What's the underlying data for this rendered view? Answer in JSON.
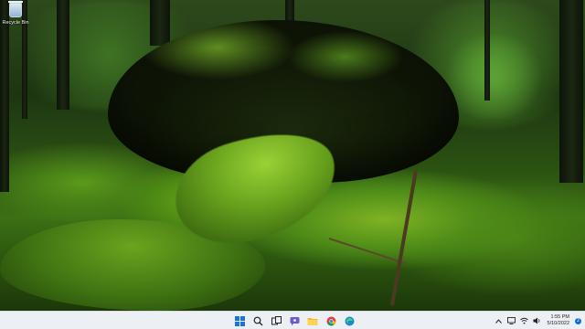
{
  "desktop": {
    "icons": [
      {
        "label": "Recycle Bin",
        "icon": "recycle-bin-icon"
      }
    ],
    "wallpaper": "forest-moss-rock"
  },
  "taskbar": {
    "pinned": [
      {
        "name": "start",
        "icon": "windows-start-icon"
      },
      {
        "name": "search",
        "icon": "search-icon"
      },
      {
        "name": "task-view",
        "icon": "task-view-icon"
      },
      {
        "name": "chat",
        "icon": "chat-icon"
      },
      {
        "name": "file-explorer",
        "icon": "folder-icon"
      },
      {
        "name": "chrome",
        "icon": "chrome-icon"
      },
      {
        "name": "edge",
        "icon": "edge-icon"
      }
    ],
    "tray": {
      "overflow_icon": "chevron-up-icon",
      "icons": [
        "display-icon",
        "wifi-icon",
        "speaker-icon"
      ],
      "time": "1:55 PM",
      "date": "5/10/2022",
      "notification_count": "2"
    },
    "colors": {
      "background": "#eceff3",
      "accent": "#0a6fd1"
    }
  }
}
